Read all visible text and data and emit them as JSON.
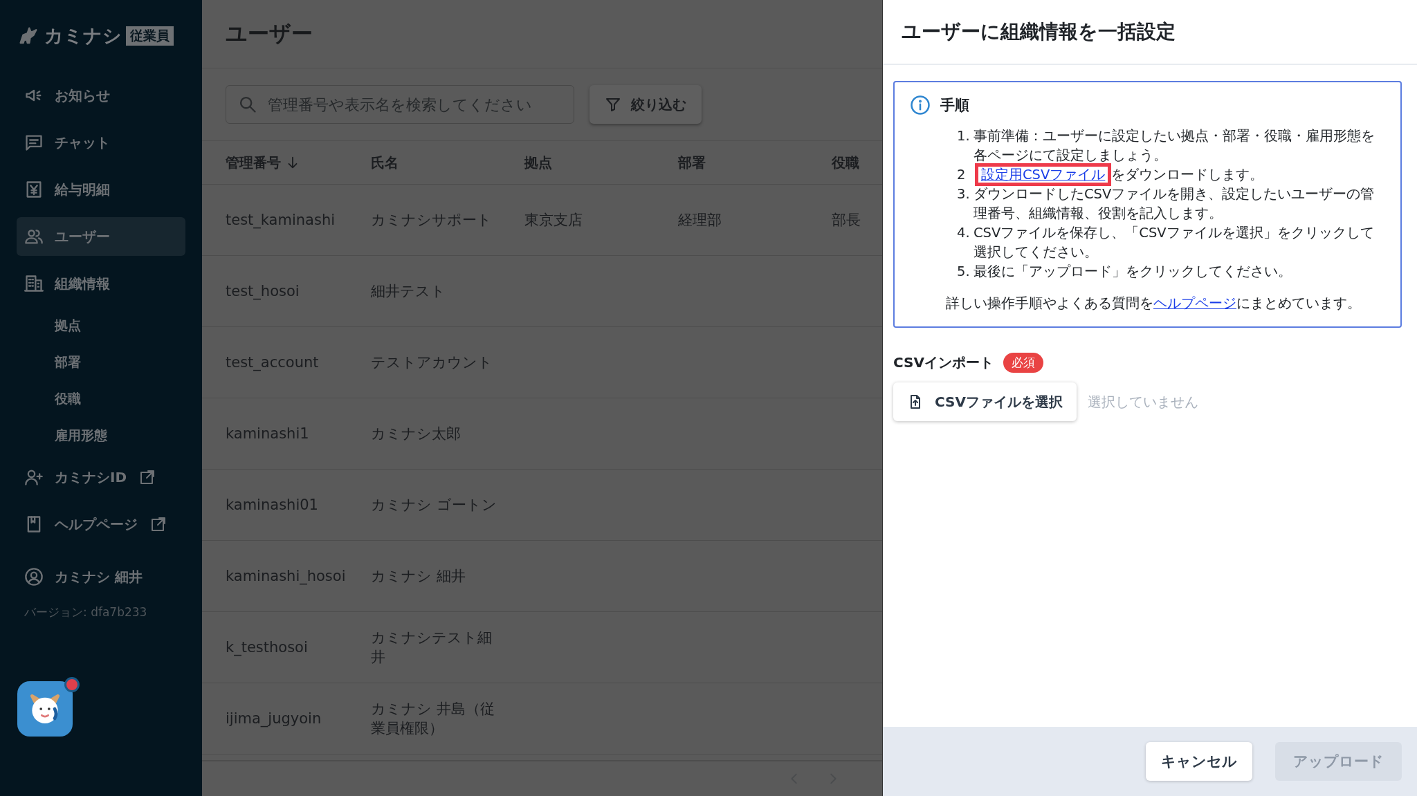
{
  "sidebar": {
    "logo": {
      "text": "カミナシ",
      "badge": "従業員"
    },
    "nav": [
      {
        "kind": "megaphone",
        "label": "お知らせ",
        "selected": false,
        "external": false
      },
      {
        "kind": "chat",
        "label": "チャット",
        "selected": false,
        "external": false
      },
      {
        "kind": "payslip",
        "label": "給与明細",
        "selected": false,
        "external": false
      },
      {
        "kind": "users",
        "label": "ユーザー",
        "selected": true,
        "external": false
      },
      {
        "kind": "building",
        "label": "組織情報",
        "selected": false,
        "external": false,
        "children": [
          {
            "label": "拠点"
          },
          {
            "label": "部署"
          },
          {
            "label": "役職"
          },
          {
            "label": "雇用形態"
          }
        ]
      },
      {
        "kind": "user-plus",
        "label": "カミナシID",
        "selected": false,
        "external": true
      },
      {
        "kind": "book",
        "label": "ヘルプページ",
        "selected": false,
        "external": true
      }
    ],
    "account": {
      "name": "カミナシ 細井",
      "version": "バージョン: dfa7b233"
    },
    "chat_bot": {
      "notification": true
    }
  },
  "page": {
    "title": "ユーザー",
    "search": {
      "placeholder": "管理番号や表示名を検索してください"
    },
    "filter_button": "絞り込む"
  },
  "table": {
    "columns": [
      {
        "label": "管理番号",
        "sorted": true
      },
      {
        "label": "氏名",
        "sorted": false
      },
      {
        "label": "拠点",
        "sorted": false
      },
      {
        "label": "部署",
        "sorted": false
      },
      {
        "label": "役職",
        "sorted": false
      }
    ],
    "rows": [
      [
        "test_kaminashi",
        "カミナシサポート",
        "東京支店",
        "経理部",
        "部長"
      ],
      [
        "test_hosoi",
        "細井テスト"
      ],
      [
        "test_account",
        "テストアカウント"
      ],
      [
        "kaminashi1",
        "カミナシ太郎"
      ],
      [
        "kaminashi01",
        "カミナシ ゴートン"
      ],
      [
        "kaminashi_hosoi",
        "カミナシ 細井"
      ],
      [
        "k_testhosoi",
        "カミナシテスト細井"
      ],
      [
        "ijima_jugyoin",
        "カミナシ 井島（従業員権限）"
      ]
    ]
  },
  "dialog": {
    "title": "ユーザーに組織情報を一括設定",
    "instructions": {
      "heading": "手順",
      "steps": [
        {
          "number": "1.",
          "text": "事前準備：ユーザーに設定したい拠点・部署・役職・雇用形態を各ページにて設定しましょう。"
        },
        {
          "number": "2",
          "link": "設定用CSVファイル",
          "highlighted": true,
          "text": "をダウンロードします。"
        },
        {
          "number": "3.",
          "text": "ダウンロードしたCSVファイルを開き、設定したいユーザーの管理番号、組織情報、役割を記入します。"
        },
        {
          "number": "4.",
          "text": "CSVファイルを保存し、「CSVファイルを選択」をクリックして選択してください。"
        },
        {
          "number": "5.",
          "text": "最後に「アップロード」をクリックしてください。"
        }
      ],
      "note": {
        "before": "詳しい操作手順やよくある質問を",
        "link": "ヘルプページ",
        "after": "にまとめています。"
      }
    },
    "csv_import": {
      "label": "CSVインポート",
      "required": "必須",
      "button": "CSVファイルを選択",
      "placeholder": "選択していません"
    },
    "buttons": [
      {
        "label": "キャンセル",
        "disabled": false
      },
      {
        "label": "アップロード",
        "disabled": true
      }
    ]
  }
}
